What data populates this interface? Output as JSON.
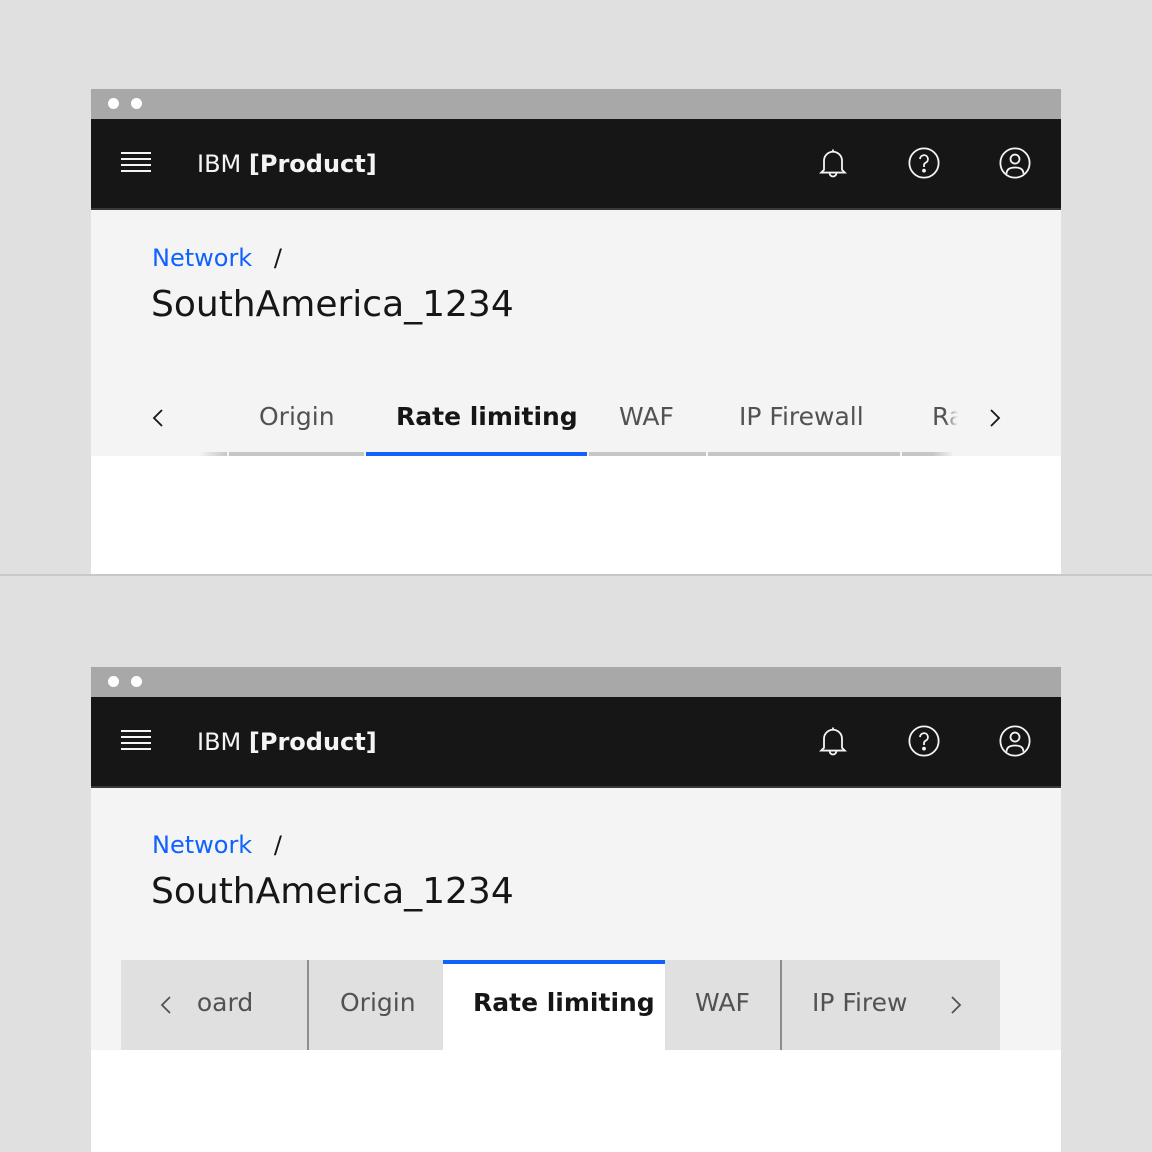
{
  "windows": [
    {
      "variant": "line-tabs",
      "shell": {
        "brand_prefix": "IBM",
        "brand_product": "[Product]",
        "icons": [
          "menu-icon",
          "notification-icon",
          "help-icon",
          "user-avatar-icon"
        ]
      },
      "breadcrumb": {
        "parent": "Network",
        "separator": "/"
      },
      "title": "SouthAmerica_1234",
      "tabs": [
        {
          "label": "Origin",
          "active": false
        },
        {
          "label": "Rate limiting",
          "active": true
        },
        {
          "label": "WAF",
          "active": false
        },
        {
          "label": "IP Firewall",
          "active": false
        },
        {
          "label": "Ra",
          "active": false,
          "truncated": true
        }
      ]
    },
    {
      "variant": "contained-tabs",
      "shell": {
        "brand_prefix": "IBM",
        "brand_product": "[Product]",
        "icons": [
          "menu-icon",
          "notification-icon",
          "help-icon",
          "user-avatar-icon"
        ]
      },
      "breadcrumb": {
        "parent": "Network",
        "separator": "/"
      },
      "title": "SouthAmerica_1234",
      "tabs": [
        {
          "label": "board",
          "active": false,
          "truncated": true
        },
        {
          "label": "Origin",
          "active": false
        },
        {
          "label": "Rate limiting",
          "active": true
        },
        {
          "label": "WAF",
          "active": false
        },
        {
          "label": "IP Firew",
          "active": false,
          "truncated": true
        }
      ]
    }
  ],
  "colors": {
    "shell_bg": "#161616",
    "link": "#0f62fe",
    "active_tab_indicator": "#0f62fe",
    "page_bg": "#f4f4f4",
    "canvas_bg": "#e0e0e0"
  }
}
